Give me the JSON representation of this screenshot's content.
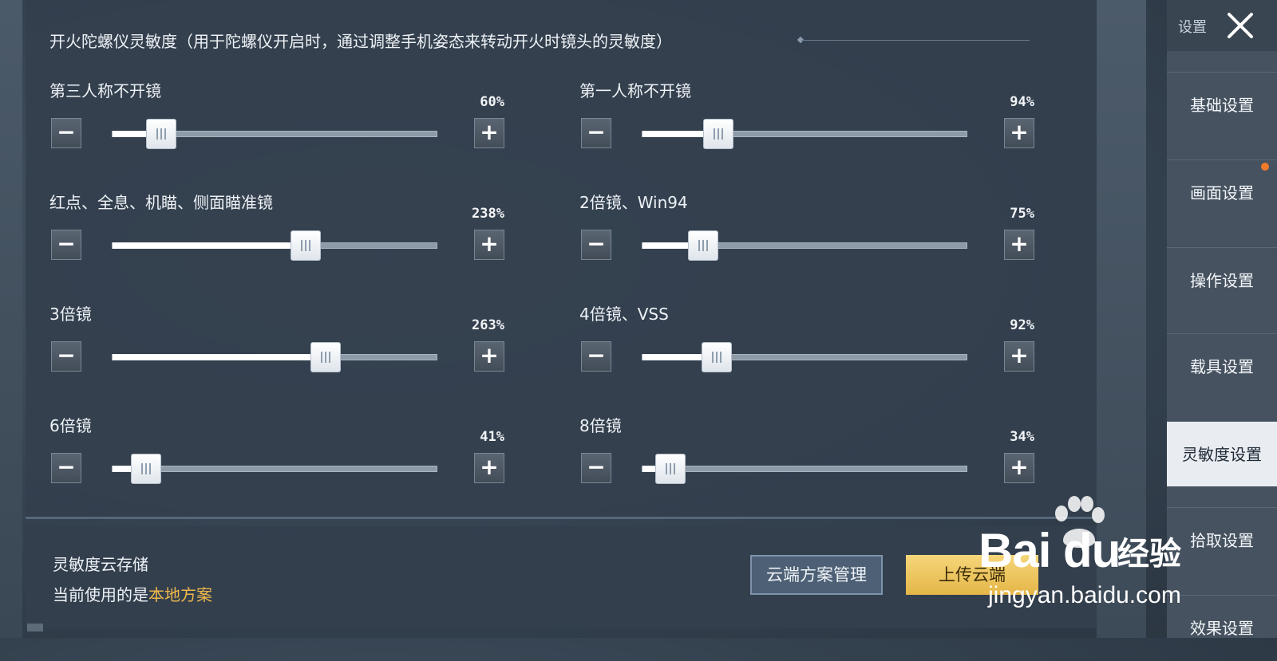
{
  "section": {
    "title": "开火陀螺仪灵敏度（用于陀螺仪开启时，通过调整手机姿态来转动开火时镜头的灵敏度）"
  },
  "settings": [
    {
      "label": "第三人称不开镜",
      "value_text": "60%",
      "value": 60
    },
    {
      "label": "第一人称不开镜",
      "value_text": "94%",
      "value": 94
    },
    {
      "label": "红点、全息、机瞄、侧面瞄准镜",
      "value_text": "238%",
      "value": 238
    },
    {
      "label": "2倍镜、Win94",
      "value_text": "75%",
      "value": 75
    },
    {
      "label": "3倍镜",
      "value_text": "263%",
      "value": 263
    },
    {
      "label": "4倍镜、VSS",
      "value_text": "92%",
      "value": 92
    },
    {
      "label": "6倍镜",
      "value_text": "41%",
      "value": 41
    },
    {
      "label": "8倍镜",
      "value_text": "34%",
      "value": 34
    }
  ],
  "slider_range": {
    "min": 0,
    "max": 400
  },
  "controls": {
    "minus": "−",
    "plus": "+"
  },
  "cloud": {
    "title": "灵敏度云存储",
    "status_prefix": "当前使用的是",
    "status_value": "本地方案",
    "manage_label": "云端方案管理",
    "upload_label": "上传云端"
  },
  "sidebar": {
    "title": "设置",
    "items": [
      {
        "label": "基础设置",
        "active": false
      },
      {
        "label": "画面设置",
        "active": false
      },
      {
        "label": "操作设置",
        "active": false
      },
      {
        "label": "载具设置",
        "active": false
      },
      {
        "label": "灵敏度设置",
        "active": true
      },
      {
        "label": "拾取设置",
        "active": false
      },
      {
        "label": "效果设置",
        "active": false
      }
    ]
  },
  "watermark": {
    "brand": "Bai  du",
    "product": "经验",
    "url": "jingyan.baidu.com"
  },
  "colors": {
    "accent_gold": "#f0b84c",
    "notify": "#f07a2a",
    "active_tab_bg": "#e9edf1"
  }
}
